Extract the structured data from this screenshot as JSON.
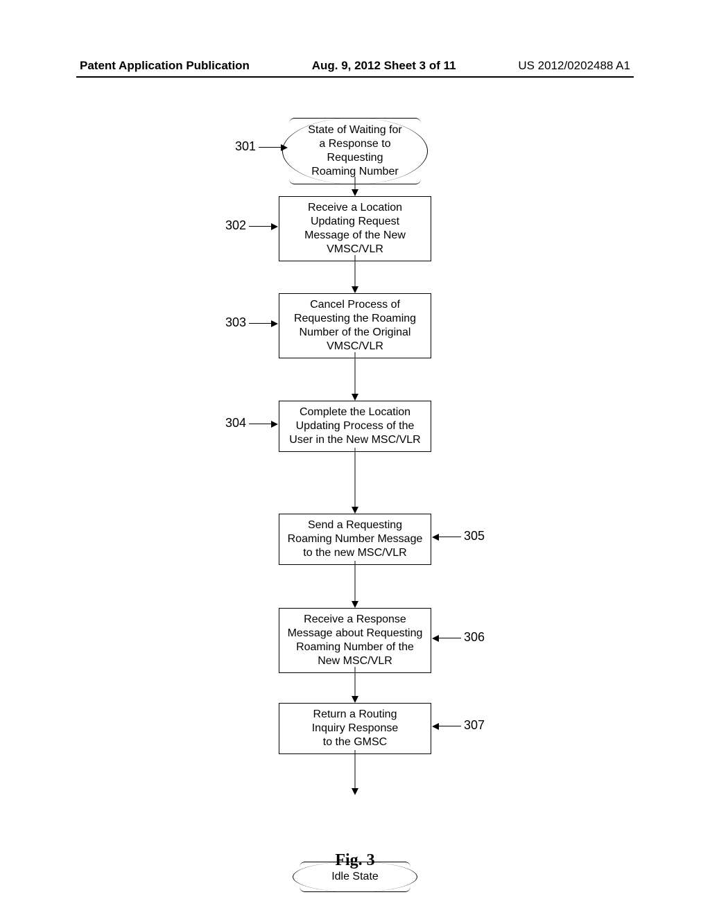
{
  "header": {
    "left": "Patent Application Publication",
    "center": "Aug. 9, 2012   Sheet 3 of 11",
    "right": "US 2012/0202488 A1"
  },
  "nodes": {
    "n301": "State of Waiting for\na Response to\nRequesting\nRoaming Number",
    "n302": "Receive a Location\nUpdating Request\nMessage of the New\nVMSC/VLR",
    "n303": "Cancel Process of\nRequesting the Roaming\nNumber of the Original\nVMSC/VLR",
    "n304": "Complete the Location\nUpdating Process of the\nUser in the New MSC/VLR",
    "n305": "Send a Requesting\nRoaming Number Message\nto the new MSC/VLR",
    "n306": "Receive a Response\nMessage about Requesting\nRoaming Number of the\nNew MSC/VLR",
    "n307": "Return a Routing\nInquiry Response\nto the GMSC",
    "idle": "Idle State"
  },
  "refs": {
    "r301": "301",
    "r302": "302",
    "r303": "303",
    "r304": "304",
    "r305": "305",
    "r306": "306",
    "r307": "307"
  },
  "figure": "Fig. 3"
}
